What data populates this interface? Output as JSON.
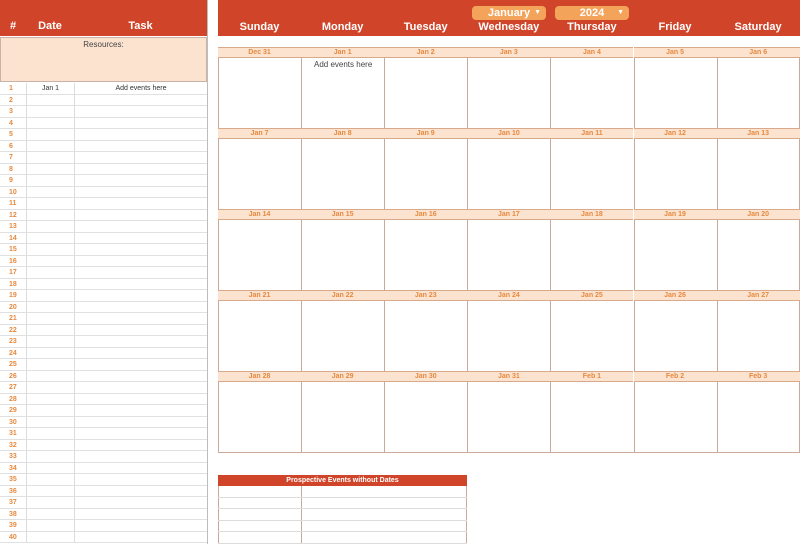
{
  "left_panel": {
    "headers": {
      "num": "#",
      "date": "Date",
      "task": "Task"
    },
    "resources_label": "Resources:",
    "first_row": {
      "date": "Jan 1",
      "task": "Add events here"
    },
    "row_count": 40
  },
  "calendar": {
    "month": "January",
    "year": "2024",
    "days": [
      "Sunday",
      "Monday",
      "Tuesday",
      "Wednesday",
      "Thursday",
      "Friday",
      "Saturday"
    ],
    "weeks": [
      [
        "Dec 31",
        "Jan 1",
        "Jan 2",
        "Jan 3",
        "Jan 4",
        "Jan 5",
        "Jan 6"
      ],
      [
        "Jan 7",
        "Jan 8",
        "Jan 9",
        "Jan 10",
        "Jan 11",
        "Jan 12",
        "Jan 13"
      ],
      [
        "Jan 14",
        "Jan 15",
        "Jan 16",
        "Jan 17",
        "Jan 18",
        "Jan 19",
        "Jan 20"
      ],
      [
        "Jan 21",
        "Jan 22",
        "Jan 23",
        "Jan 24",
        "Jan 25",
        "Jan 26",
        "Jan 27"
      ],
      [
        "Jan 28",
        "Jan 29",
        "Jan 30",
        "Jan 31",
        "Feb 1",
        "Feb 2",
        "Feb 3"
      ]
    ],
    "events": {
      "0-1": "Add events here"
    }
  },
  "prospective": {
    "title": "Prospective Events without Dates",
    "row_count": 5
  },
  "colors": {
    "header": "#d0452a",
    "accent": "#f4a35b",
    "date_bar": "#fce3cf",
    "date_text": "#e6893f"
  }
}
